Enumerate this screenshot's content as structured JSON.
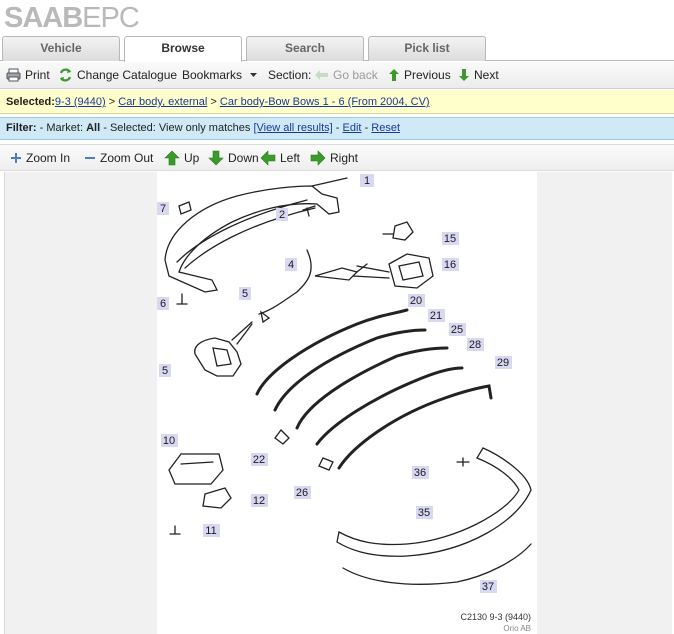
{
  "logo": {
    "brand": "SAAB",
    "suffix": "EPC"
  },
  "tabs": [
    {
      "label": "Vehicle",
      "active": false
    },
    {
      "label": "Browse",
      "active": true
    },
    {
      "label": "Search",
      "active": false
    },
    {
      "label": "Pick list",
      "active": false
    }
  ],
  "toolbar": {
    "print": "Print",
    "change_catalogue": "Change Catalogue",
    "bookmarks": "Bookmarks",
    "section": "Section:",
    "go_back": "Go back",
    "previous": "Previous",
    "next": "Next"
  },
  "selected": {
    "label": "Selected:",
    "model": "9-3 (9440)",
    "sep": ">",
    "group": "Car body, external",
    "section": "Car body-Bow Bows 1 - 6 (From 2004, CV)"
  },
  "filter": {
    "label": "Filter:",
    "market_prefix": "- Market:",
    "market": "All",
    "selected_prefix": "- Selected:",
    "selected_value": "View only matches",
    "view_all": "[View all results]",
    "edit": "Edit",
    "reset": "Reset",
    "dash": "-"
  },
  "zoom": {
    "zoom_in": "Zoom In",
    "zoom_out": "Zoom Out",
    "up": "Up",
    "down": "Down",
    "left": "Left",
    "right": "Right"
  },
  "diagram": {
    "callouts": [
      "1",
      "2",
      "7",
      "6",
      "4",
      "5",
      "5",
      "15",
      "16",
      "20",
      "21",
      "25",
      "28",
      "29",
      "10",
      "22",
      "26",
      "12",
      "11",
      "36",
      "35",
      "37"
    ],
    "caption": "C2130 9-3 (9440)",
    "copyright": "Orio AB"
  },
  "colors": {
    "selbar_bg": "#ffffcc",
    "filterbar_bg": "#cfe9f7",
    "link": "#1a3a9a",
    "icon_green": "#3a9a2a",
    "callout_bg": "#d8d8f2"
  }
}
